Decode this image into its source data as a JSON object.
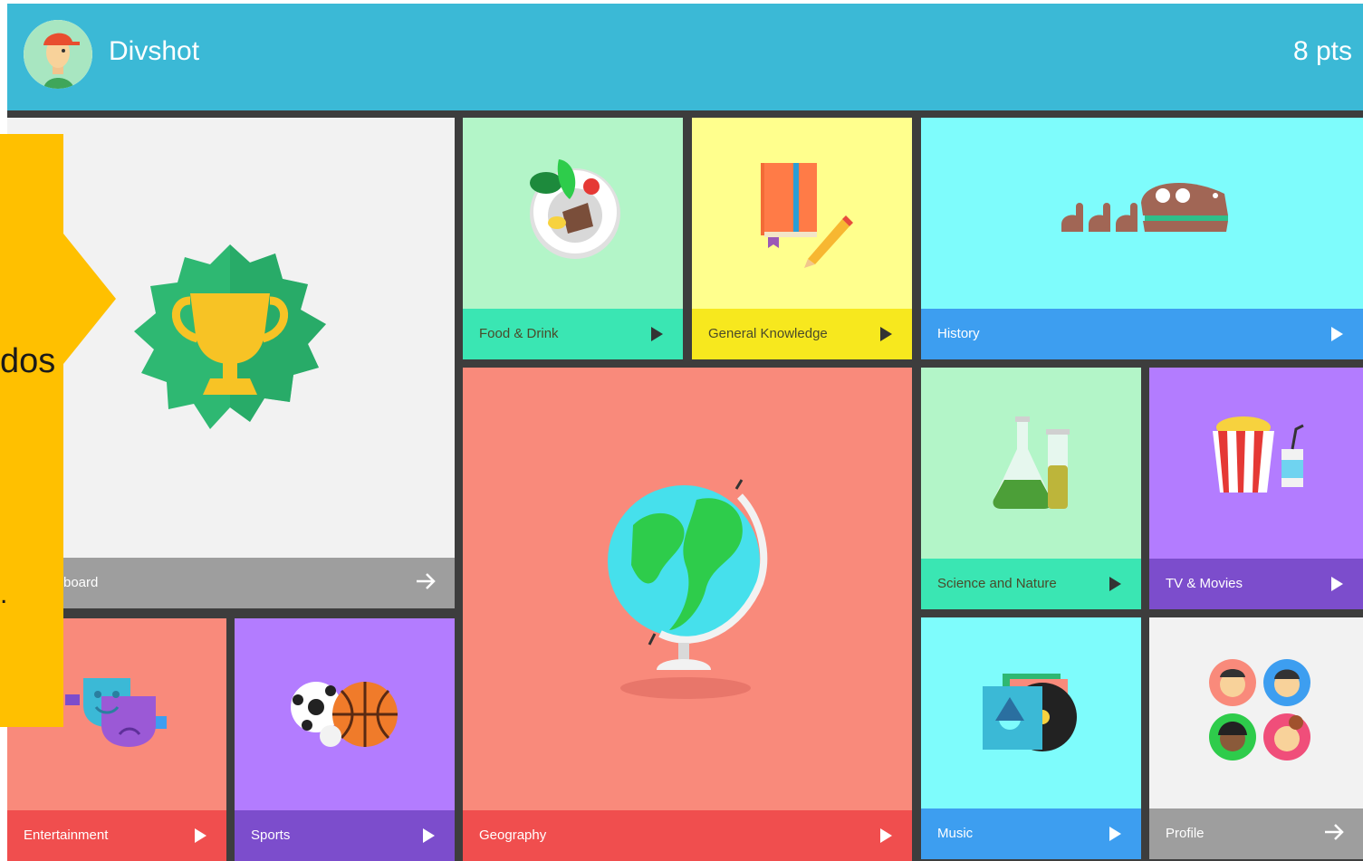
{
  "header": {
    "title": "Divshot",
    "points": "8 pts"
  },
  "tiles": {
    "leaderboard": {
      "label": "board"
    },
    "food": {
      "label": "Food & Drink"
    },
    "general": {
      "label": "General Knowledge"
    },
    "history": {
      "label": "History"
    },
    "geography": {
      "label": "Geography"
    },
    "science": {
      "label": "Science and Nature"
    },
    "tv": {
      "label": "TV & Movies"
    },
    "entertainment": {
      "label": "Entertainment"
    },
    "sports": {
      "label": "Sports"
    },
    "music": {
      "label": "Music"
    },
    "profile": {
      "label": "Profile"
    }
  },
  "callout": {
    "text": "dos",
    "dot": "."
  },
  "colors": {
    "header": "#3bb9d6",
    "board": "#3d3d3d",
    "callout": "#ffc000"
  }
}
